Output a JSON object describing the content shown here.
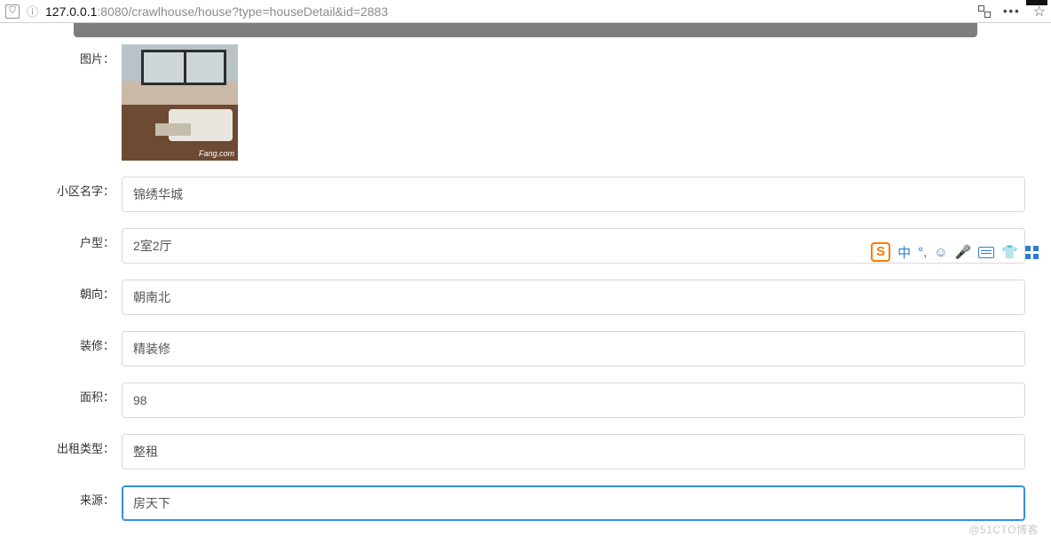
{
  "addressbar": {
    "host": "127.0.0.1",
    "port": ":8080",
    "path": "/crawlhouse/house?type=houseDetail&id=2883",
    "dots": "•••"
  },
  "labels": {
    "image": "图片：",
    "community": "小区名字：",
    "layout": "户型：",
    "orientation": "朝向：",
    "decoration": "装修：",
    "area": "面积：",
    "rent_type": "出租类型：",
    "source": "来源："
  },
  "values": {
    "community": "锦绣华城",
    "layout": "2室2厅",
    "orientation": "朝南北",
    "decoration": "精装修",
    "area": "98",
    "rent_type": "整租",
    "source": "房天下"
  },
  "image_brand": "Fang.com",
  "ime": {
    "logo": "S",
    "lang": "中",
    "punct": "°,",
    "face": "☺",
    "mic": "🎤",
    "shirt": "👕"
  },
  "watermark": "@51CTO博客"
}
